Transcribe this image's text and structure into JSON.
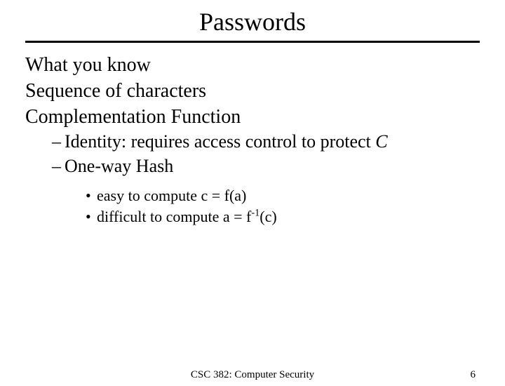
{
  "title": "Passwords",
  "level1": {
    "a": "What you know",
    "b": "Sequence of characters",
    "c": "Complementation Function"
  },
  "level2": {
    "identity_pre": "Identity: requires access control to protect ",
    "identity_tail": "C",
    "hash": "One-way Hash"
  },
  "level3": {
    "easy": "easy to compute c = f(a)",
    "hard_pre": "difficult to compute a = f",
    "hard_sup": "-1",
    "hard_post": "(c)"
  },
  "footer": {
    "course": "CSC 382: Computer Security",
    "page": "6"
  },
  "glyph": {
    "dash": "–",
    "bullet": "•"
  }
}
